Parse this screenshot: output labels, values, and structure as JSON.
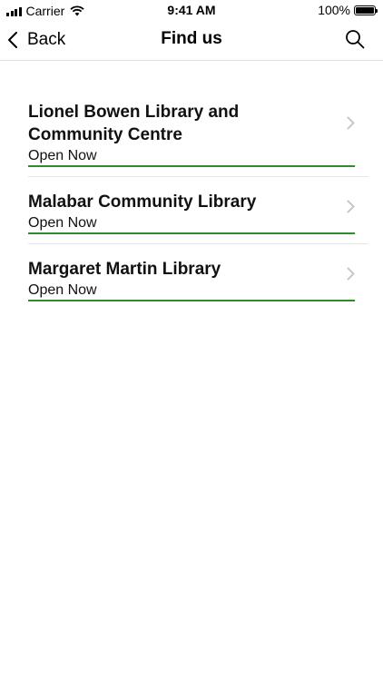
{
  "status_bar": {
    "carrier": "Carrier",
    "time": "9:41 AM",
    "battery": "100%"
  },
  "nav": {
    "back_label": "Back",
    "title": "Find us",
    "icons": {
      "back": "chevron-left-icon",
      "search": "search-icon"
    }
  },
  "libraries": [
    {
      "name": "Lionel Bowen Library and Community Centre",
      "status": "Open Now"
    },
    {
      "name": "Malabar Community Library",
      "status": "Open Now"
    },
    {
      "name": "Margaret Martin Library",
      "status": "Open Now"
    }
  ],
  "colors": {
    "status_open": "#2e8b2e",
    "chevron": "#c7c7cc",
    "divider": "#e6e6e6"
  }
}
